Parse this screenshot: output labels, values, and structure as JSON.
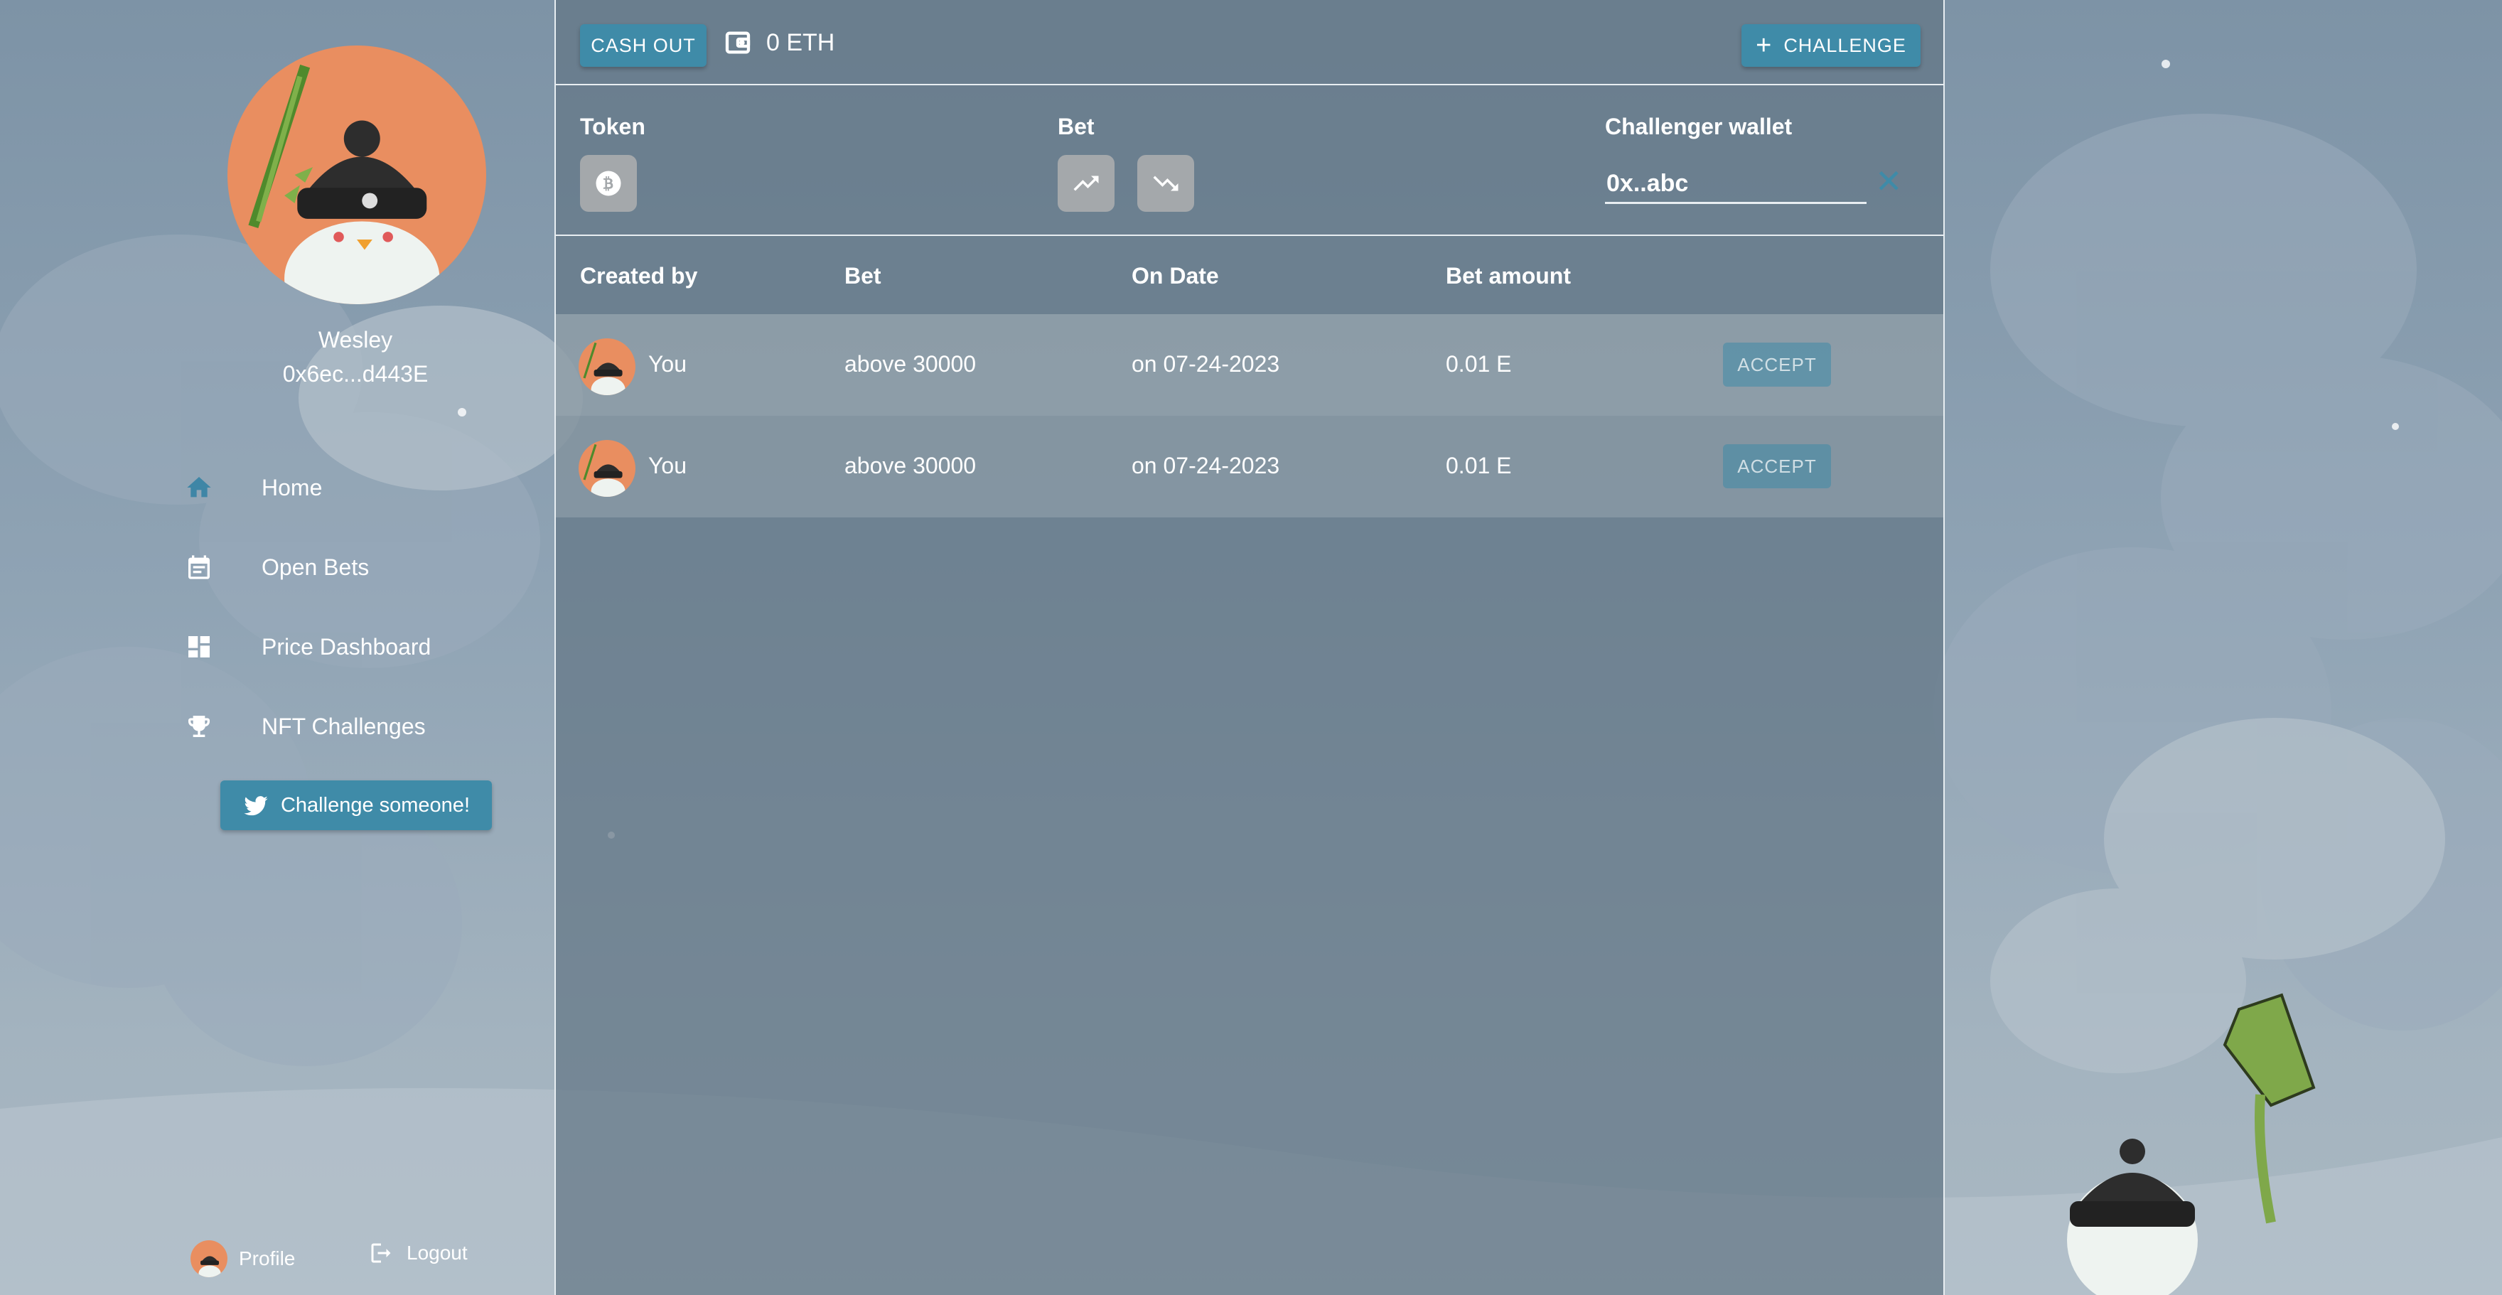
{
  "user": {
    "name": "Wesley",
    "wallet": "0x6ec...d443E"
  },
  "nav": [
    {
      "label": "Home",
      "icon": "home-icon",
      "active": true
    },
    {
      "label": "Open Bets",
      "icon": "calendar-icon"
    },
    {
      "label": "Price Dashboard",
      "icon": "dashboard-icon"
    },
    {
      "label": "NFT Challenges",
      "icon": "trophy-icon"
    }
  ],
  "twitter_button": "Challenge someone!",
  "footer": {
    "profile": "Profile",
    "logout": "Logout"
  },
  "topbar": {
    "cash_out": "CASH OUT",
    "balance": "0 ETH",
    "challenge": "CHALLENGE"
  },
  "filters": {
    "token_label": "Token",
    "bet_label": "Bet",
    "wallet_label": "Challenger wallet",
    "wallet_value": "0x..abc"
  },
  "table": {
    "headers": [
      "Created by",
      "Bet",
      "On Date",
      "Bet amount"
    ],
    "rows": [
      {
        "created_by": "You",
        "bet": "above 30000",
        "date": "on 07-24-2023",
        "amount": "0.01 E",
        "action": "ACCEPT"
      },
      {
        "created_by": "You",
        "bet": "above 30000",
        "date": "on 07-24-2023",
        "amount": "0.01 E",
        "action": "ACCEPT"
      }
    ]
  },
  "colors": {
    "accent": "#3f8ba8",
    "avatar_bg": "#e98e60",
    "panel": "#627685"
  }
}
